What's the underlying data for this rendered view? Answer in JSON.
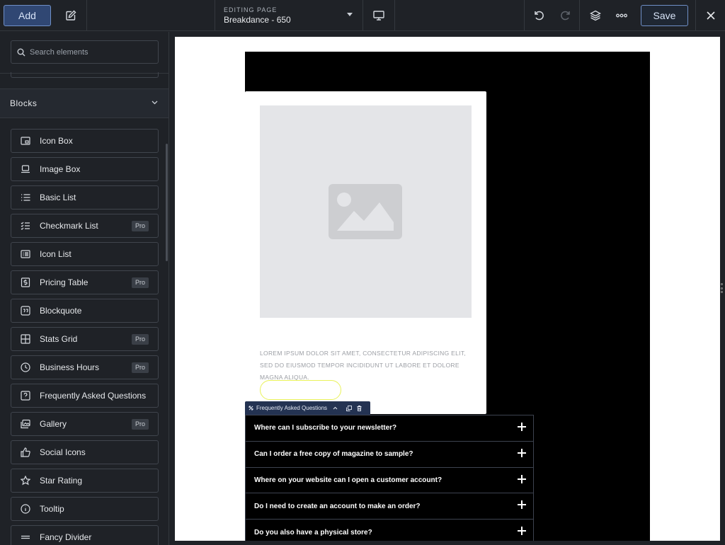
{
  "topbar": {
    "add_label": "Add",
    "editing_label": "EDITING PAGE",
    "page_name": "Breakdance - 650",
    "save_label": "Save"
  },
  "sidebar": {
    "search_placeholder": "Search elements",
    "section_title": "Blocks",
    "items": [
      {
        "label": "Icon Box",
        "icon": "icon-box-icon",
        "pro": ""
      },
      {
        "label": "Image Box",
        "icon": "image-box-icon",
        "pro": ""
      },
      {
        "label": "Basic List",
        "icon": "list-icon",
        "pro": ""
      },
      {
        "label": "Checkmark List",
        "icon": "checklist-icon",
        "pro": "Pro"
      },
      {
        "label": "Icon List",
        "icon": "icon-list-icon",
        "pro": ""
      },
      {
        "label": "Pricing Table",
        "icon": "dollar-icon",
        "pro": "Pro"
      },
      {
        "label": "Blockquote",
        "icon": "quote-icon",
        "pro": ""
      },
      {
        "label": "Stats Grid",
        "icon": "grid-icon",
        "pro": "Pro"
      },
      {
        "label": "Business Hours",
        "icon": "clock-icon",
        "pro": "Pro"
      },
      {
        "label": "Frequently Asked Questions",
        "icon": "question-icon",
        "pro": ""
      },
      {
        "label": "Gallery",
        "icon": "gallery-icon",
        "pro": "Pro"
      },
      {
        "label": "Social Icons",
        "icon": "thumbs-up-icon",
        "pro": ""
      },
      {
        "label": "Star Rating",
        "icon": "star-icon",
        "pro": ""
      },
      {
        "label": "Tooltip",
        "icon": "info-icon",
        "pro": ""
      },
      {
        "label": "Fancy Divider",
        "icon": "divider-icon",
        "pro": ""
      }
    ]
  },
  "canvas": {
    "card_text": "LOREM IPSUM DOLOR SIT AMET, CONSECTETUR ADIPISCING ELIT, SED DO EIUSMOD TEMPOR INCIDIDUNT UT LABORE ET DOLORE MAGNA ALIQUA.",
    "faq_tag": "Frequently Asked Questions",
    "faq_items": [
      "Where can I subscribe to your newsletter?",
      "Can I order a free copy of magazine to sample?",
      "Where on your website can I open a customer account?",
      "Do I need to create an account to make an order?",
      "Do you also have a physical store?"
    ]
  },
  "colors": {
    "accent": "#6f8fc7",
    "add_bg": "#304773",
    "faq_tag_bg": "#243352",
    "button_outline": "#e9f25a"
  }
}
